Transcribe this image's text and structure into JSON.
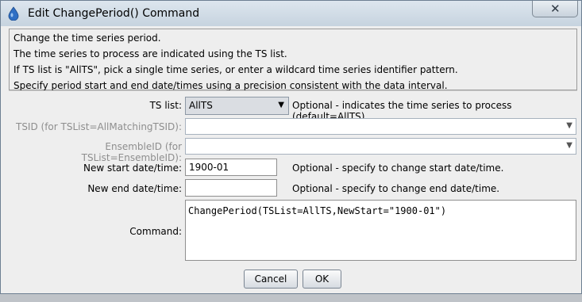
{
  "window": {
    "title": "Edit ChangePeriod() Command",
    "close_label": "✕"
  },
  "info_lines": [
    "Change the time series period.",
    "The time series to process are indicated using the TS list.",
    "If TS list is \"AllTS\", pick a single time series, or enter a wildcard time series identifier pattern.",
    "Specify period start and end date/times using a precision consistent with the data interval."
  ],
  "form": {
    "tslist_label": "TS list:",
    "tslist_value": "AllTS",
    "tslist_note": "Optional - indicates the time series to process (default=AllTS).",
    "tsid_label": "TSID (for TSList=AllMatchingTSID):",
    "tsid_value": "",
    "ensemble_label": "EnsembleID (for TSList=EnsembleID):",
    "ensemble_value": "",
    "start_label": "New start date/time:",
    "start_value": "1900-01",
    "start_note": "Optional - specify to change start date/time.",
    "end_label": "New end date/time:",
    "end_value": "",
    "end_note": "Optional - specify to change end date/time.",
    "command_label": "Command:",
    "command_value": "ChangePeriod(TSList=AllTS,NewStart=\"1900-01\")"
  },
  "buttons": {
    "cancel": "Cancel",
    "ok": "OK"
  },
  "colors": {
    "titlebar": "#c6d3df",
    "dialog_bg": "#eeeeee"
  }
}
